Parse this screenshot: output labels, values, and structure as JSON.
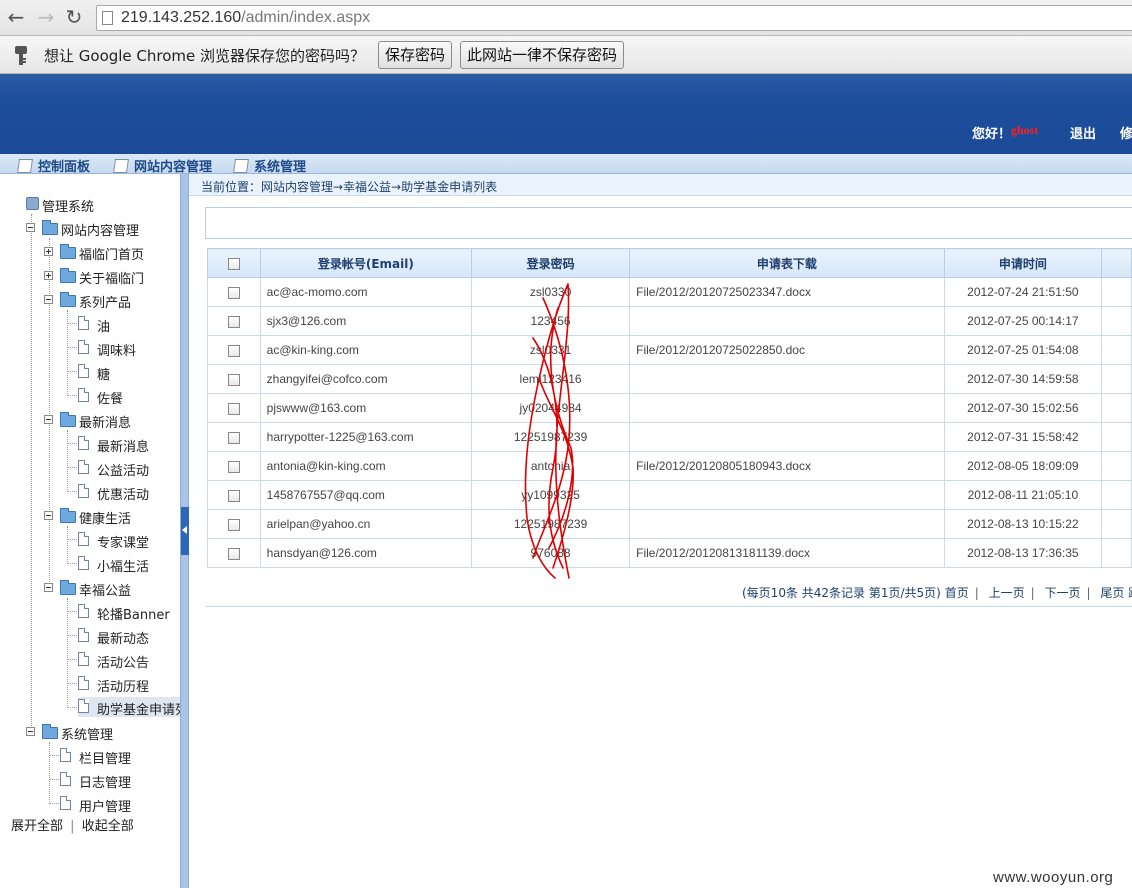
{
  "browser": {
    "url_host": "219.143.252.160",
    "url_path": "/admin/index.aspx",
    "infobar": {
      "message": "想让 Google Chrome 浏览器保存您的密码吗？",
      "save_label": "保存密码",
      "never_label": "此网站一律不保存密码"
    }
  },
  "header": {
    "greeting": "您好！",
    "username": "ghost",
    "logout_label": "退出",
    "modify_label": "修"
  },
  "menu": [
    {
      "label": "控制面板"
    },
    {
      "label": "网站内容管理"
    },
    {
      "label": "系统管理"
    }
  ],
  "tree": {
    "root": "管理系统",
    "content_mgmt": "网站内容管理",
    "fulin_home": "福临门首页",
    "about_fulin": "关于福临门",
    "series": "系列产品",
    "oil": "油",
    "seasoning": "调味料",
    "sugar": "糖",
    "meal": "佐餐",
    "news_group": "最新消息",
    "news": "最新消息",
    "charity_events": "公益活动",
    "promo_events": "优惠活动",
    "health_life": "健康生活",
    "expert_class": "专家课堂",
    "xiaofu_life": "小福生活",
    "happy_charity": "幸福公益",
    "banner": "轮播Banner",
    "latest_updates": "最新动态",
    "event_notice": "活动公告",
    "event_history": "活动历程",
    "grant_list": "助学基金申请列表",
    "sys_mgmt": "系统管理",
    "column_mgmt": "栏目管理",
    "log_mgmt": "日志管理",
    "user_mgmt": "用户管理",
    "expand_all": "展开全部",
    "collapse_all": "收起全部"
  },
  "breadcrumb": "当前位置：网站内容管理→幸福公益→助学基金申请列表",
  "table": {
    "headers": [
      "登录帐号(Email)",
      "登录密码",
      "申请表下载",
      "申请时间"
    ],
    "rows": [
      {
        "email": "ac@ac-momo.com",
        "password": "zsl0330",
        "file": "File/2012/20120725023347.docx",
        "time": "2012-07-24 21:51:50"
      },
      {
        "email": "sjx3@126.com",
        "password": "123456",
        "file": "",
        "time": "2012-07-25 00:14:17"
      },
      {
        "email": "ac@kin-king.com",
        "password": "zsl0331",
        "file": "File/2012/20120725022850.doc",
        "time": "2012-07-25 01:54:08"
      },
      {
        "email": "zhangyifei@cofco.com",
        "password": "lemi123416",
        "file": "",
        "time": "2012-07-30 14:59:58"
      },
      {
        "email": "pjswww@163.com",
        "password": "jy02044984",
        "file": "",
        "time": "2012-07-30 15:02:56"
      },
      {
        "email": "harrypotter-1225@163.com",
        "password": "12251987239",
        "file": "",
        "time": "2012-07-31 15:58:42"
      },
      {
        "email": "antonia@kin-king.com",
        "password": "antonia",
        "file": "File/2012/20120805180943.docx",
        "time": "2012-08-05 18:09:09"
      },
      {
        "email": "1458767557@qq.com",
        "password": "yy1099325",
        "file": "",
        "time": "2012-08-11 21:05:10"
      },
      {
        "email": "arielpan@yahoo.cn",
        "password": "12251987239",
        "file": "",
        "time": "2012-08-13 10:15:22"
      },
      {
        "email": "hansdyan@126.com",
        "password": "976088",
        "file": "File/2012/20120813181139.docx",
        "time": "2012-08-13 17:36:35"
      }
    ]
  },
  "pager": {
    "summary": "(每页10条  共42条记录  第1页/共5页)",
    "first": "首页",
    "prev": "上一页",
    "next": "下一页",
    "last": "尾页",
    "jump": "跳"
  },
  "watermark": "www.wooyun.org",
  "colors": {
    "header_blue": "#1d4e9c",
    "username_red": "#ff2020",
    "scribble_red": "#e00000"
  }
}
